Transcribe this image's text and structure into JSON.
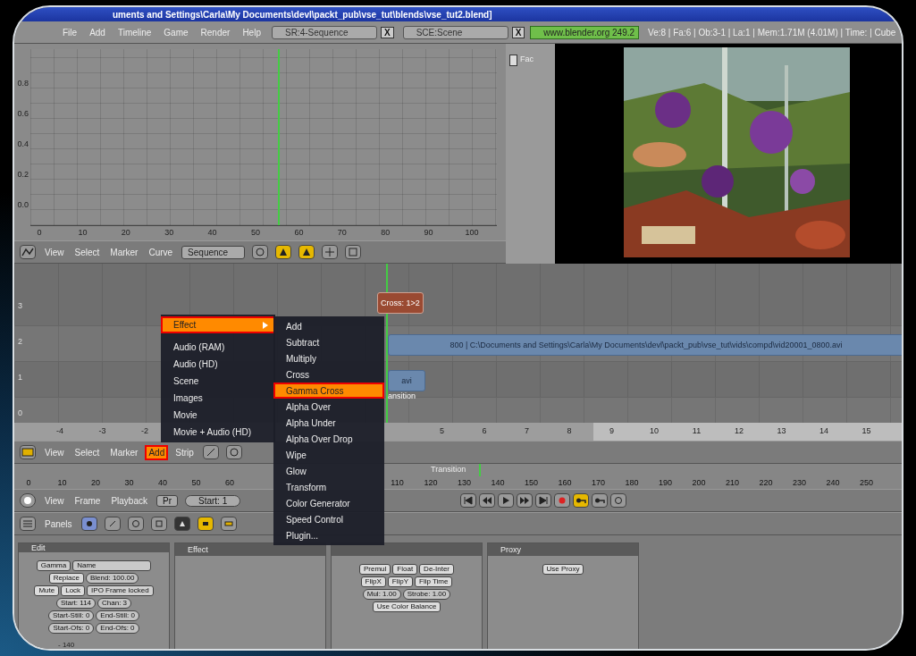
{
  "window": {
    "title": "uments and Settings\\Carla\\My Documents\\devl\\packt_pub\\vse_tut\\blends\\vse_tut2.blend]"
  },
  "menu_bar": {
    "menus": [
      "File",
      "Add",
      "Timeline",
      "Game",
      "Render",
      "Help"
    ],
    "selectors": [
      {
        "label": "SR:4-Sequence",
        "close": "X"
      },
      {
        "label": "SCE:Scene",
        "close": "X"
      }
    ],
    "version": "www.blender.org 249.2",
    "stats": "Ve:8 | Fa:6 | Ob:3-1 | La:1 | Mem:1.71M (4.01M) | Time: | Cube"
  },
  "ipo_editor": {
    "y_ticks": [
      "0.8",
      "0.6",
      "0.4",
      "0.2",
      "0.0"
    ],
    "x_ticks": [
      "0",
      "10",
      "20",
      "30",
      "40",
      "50",
      "60",
      "70",
      "80",
      "90",
      "100"
    ],
    "channel": {
      "label": "Fac",
      "checked": false
    },
    "header": {
      "menus": [
        "View",
        "Select",
        "Marker",
        "Curve"
      ],
      "block": "Sequence"
    }
  },
  "sequencer": {
    "channels": [
      {
        "number": "3",
        "strips": [
          {
            "kind": "effect",
            "label": "Cross: 1>2"
          }
        ]
      },
      {
        "number": "2",
        "strips": [
          {
            "kind": "movie",
            "label": "800 | C:\\Documents and Settings\\Carla\\My Documents\\devl\\packt_pub\\vse_tut\\vids\\compd\\vid20001_0800.avi"
          }
        ]
      },
      {
        "number": "1",
        "strips": [
          {
            "kind": "movie",
            "label": "avi",
            "caption": "ansition"
          }
        ]
      },
      {
        "number": "0"
      }
    ],
    "ruler": [
      "-4",
      "-3",
      "-2",
      "5",
      "6",
      "7",
      "8",
      "9",
      "10",
      "11",
      "12",
      "13",
      "14",
      "15"
    ],
    "header": {
      "menus": [
        {
          "label": "View",
          "selected": false
        },
        {
          "label": "Select",
          "selected": false
        },
        {
          "label": "Marker",
          "selected": false
        },
        {
          "label": "Add",
          "selected": true
        },
        {
          "label": "Strip",
          "selected": false
        }
      ]
    }
  },
  "timeline": {
    "ruler": [
      "0",
      "10",
      "20",
      "30",
      "40",
      "50",
      "60",
      "110",
      "120",
      "130",
      "140",
      "150",
      "160",
      "170",
      "180",
      "190",
      "200",
      "210",
      "220",
      "230",
      "240",
      "250"
    ],
    "marker": "Transition",
    "header": {
      "menus": [
        "View",
        "Frame",
        "Playback"
      ],
      "preview_range": "Pr",
      "start": "Start: 1"
    }
  },
  "buttons_window": {
    "header": {
      "label": "Panels"
    },
    "panels": [
      {
        "title": "Edit",
        "rows": [
          [
            {
              "kind": "label",
              "text": "Gamma"
            },
            {
              "kind": "field",
              "text": "Name"
            }
          ],
          [
            {
              "kind": "button",
              "text": "Replace"
            },
            {
              "kind": "number",
              "text": "Blend: 100.00"
            }
          ],
          [
            {
              "kind": "button",
              "text": "Mute"
            },
            {
              "kind": "button",
              "text": "Lock"
            },
            {
              "kind": "toggle",
              "text": "IPO Frame locked"
            }
          ],
          [
            {
              "kind": "number",
              "text": "Start: 114"
            },
            {
              "kind": "number",
              "text": "Chan: 3"
            }
          ],
          [
            {
              "kind": "number",
              "text": "Start-Still: 0"
            },
            {
              "kind": "number",
              "text": "End-Still: 0"
            }
          ],
          [
            {
              "kind": "number",
              "text": "Start-Ofs: 0"
            },
            {
              "kind": "number",
              "text": "End-Ofs: 0"
            }
          ]
        ],
        "note": "- 140"
      },
      {
        "title": "Effect"
      },
      {
        "rows": [
          [
            {
              "kind": "button",
              "text": "Premul"
            },
            {
              "kind": "button",
              "text": "Float"
            },
            {
              "kind": "button",
              "text": "De-Inter"
            }
          ],
          [
            {
              "kind": "button",
              "text": "FlipX"
            },
            {
              "kind": "button",
              "text": "FlipY"
            },
            {
              "kind": "button",
              "text": "Flip Time"
            }
          ],
          [
            {
              "kind": "number",
              "text": "Mul: 1.00"
            },
            {
              "kind": "number",
              "text": "Strobe: 1.00"
            }
          ],
          [
            {
              "kind": "button",
              "text": "Use Color Balance"
            }
          ]
        ]
      },
      {
        "title": "Proxy",
        "rows": [
          [
            {
              "kind": "button",
              "text": "Use Proxy"
            }
          ]
        ]
      }
    ]
  },
  "add_menu": {
    "items": [
      {
        "label": "Effect",
        "selected": true,
        "submenu": true
      },
      {
        "label": "Audio (RAM)",
        "selected": false
      },
      {
        "label": "Audio (HD)",
        "selected": false
      },
      {
        "label": "Scene",
        "selected": false
      },
      {
        "label": "Images",
        "selected": false
      },
      {
        "label": "Movie",
        "selected": false
      },
      {
        "label": "Movie + Audio (HD)",
        "selected": false
      }
    ]
  },
  "effect_menu": {
    "items": [
      {
        "label": "Add",
        "selected": false
      },
      {
        "label": "Subtract",
        "selected": false
      },
      {
        "label": "Multiply",
        "selected": false
      },
      {
        "label": "Cross",
        "selected": false
      },
      {
        "label": "Gamma Cross",
        "selected": true
      },
      {
        "label": "Alpha Over",
        "selected": false
      },
      {
        "label": "Alpha Under",
        "selected": false
      },
      {
        "label": "Alpha Over Drop",
        "selected": false
      },
      {
        "label": "Wipe",
        "selected": false
      },
      {
        "label": "Glow",
        "selected": false
      },
      {
        "label": "Transform",
        "selected": false
      },
      {
        "label": "Color Generator",
        "selected": false
      },
      {
        "label": "Speed Control",
        "selected": false
      },
      {
        "label": "Plugin...",
        "selected": false
      }
    ]
  }
}
